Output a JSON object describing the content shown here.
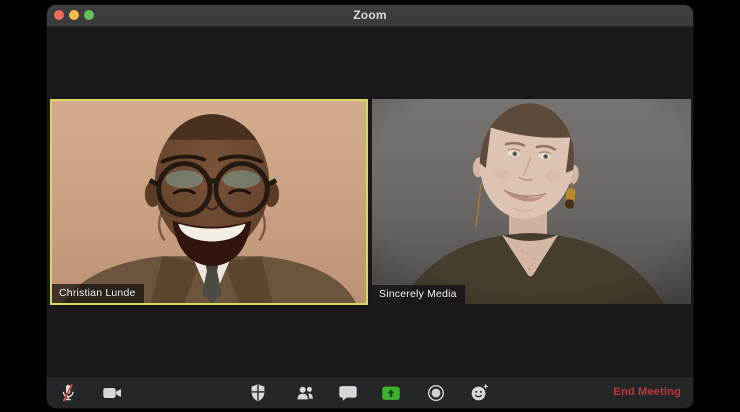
{
  "window": {
    "title": "Zoom"
  },
  "titlebar": {
    "controls": [
      "close",
      "minimize",
      "fullscreen"
    ]
  },
  "participants": [
    {
      "name": "Christian Lunde",
      "active_speaker": true
    },
    {
      "name": "Sincerely Media",
      "active_speaker": false
    }
  ],
  "toolbar": {
    "buttons": [
      {
        "icon": "microphone-muted-icon"
      },
      {
        "icon": "video-camera-icon"
      },
      {
        "icon": "security-shield-icon"
      },
      {
        "icon": "participants-icon"
      },
      {
        "icon": "chat-bubble-icon"
      },
      {
        "icon": "share-screen-icon"
      },
      {
        "icon": "record-icon"
      },
      {
        "icon": "reactions-icon"
      }
    ],
    "end_meeting_label": "End Meeting"
  },
  "colors": {
    "active_speaker_border": "#d5d95e",
    "share_screen_green": "#3eb22c",
    "end_meeting_red": "#c03538",
    "mute_slash_red": "#e0463c",
    "traffic_light_red": "#ee6a5f",
    "traffic_light_yellow": "#f5bd4f",
    "traffic_light_green": "#61c455"
  }
}
